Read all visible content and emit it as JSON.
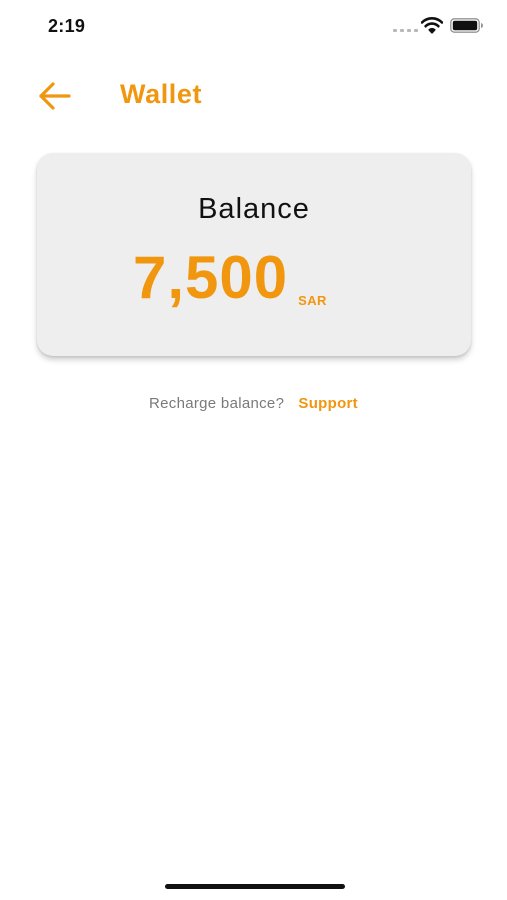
{
  "status_bar": {
    "time": "2:19",
    "icons": [
      "signal-icon",
      "wifi-icon",
      "battery-icon"
    ]
  },
  "header": {
    "back_icon": "arrow-left-icon",
    "title": "Wallet"
  },
  "balance_card": {
    "label": "Balance",
    "amount": "7,500",
    "currency": "SAR"
  },
  "recharge": {
    "prompt": "Recharge balance?",
    "link_label": "Support"
  },
  "colors": {
    "accent": "#F1960F",
    "card_background": "#EEEEEE",
    "text_primary": "#111111",
    "text_secondary": "#7A7A7A"
  }
}
